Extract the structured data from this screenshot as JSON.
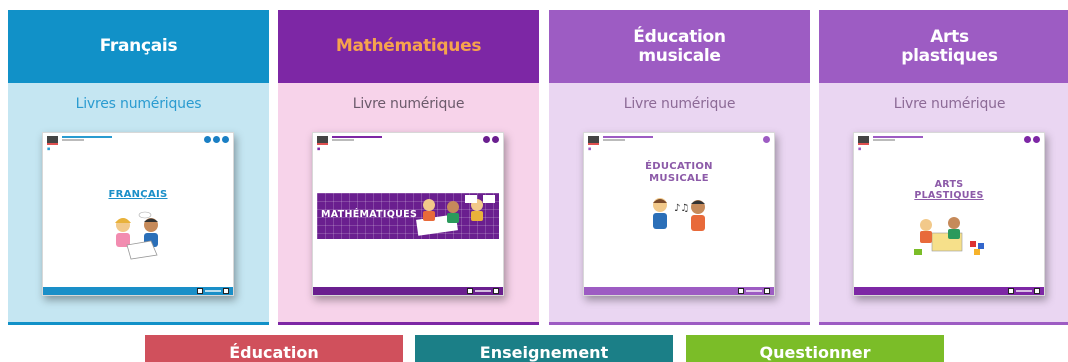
{
  "cards": [
    {
      "id": "francais",
      "title": "Français",
      "subtitle": "Livres numériques",
      "cover_title": "FRANÇAIS"
    },
    {
      "id": "maths",
      "title": "Mathématiques",
      "subtitle": "Livre numérique",
      "cover_title": "MATHÉMATIQUES"
    },
    {
      "id": "musique",
      "title_line1": "Éducation",
      "title_line2": "musicale",
      "subtitle": "Livre numérique",
      "cover_title_line1": "ÉDUCATION",
      "cover_title_line2": "MUSICALE"
    },
    {
      "id": "arts",
      "title_line1": "Arts",
      "title_line2": "plastiques",
      "subtitle": "Livre numérique",
      "cover_title_line1": "ARTS",
      "cover_title_line2": "PLASTIQUES"
    }
  ],
  "bottom_buttons": [
    "Éducation",
    "Enseignement",
    "Questionner"
  ],
  "colors": {
    "francais_header": "#1191c8",
    "francais_body": "#c5e6f2",
    "maths_header": "#7d27a5",
    "maths_title": "#f6a34d",
    "maths_body": "#f7d3ea",
    "musique_header": "#9d5cc3",
    "musique_body": "#ead6f2",
    "arts_header": "#9d5cc3",
    "arts_body": "#ead6f2",
    "btn_education": "#d0505c",
    "btn_enseignement": "#1b7f87",
    "btn_questionner": "#7bbd28"
  },
  "icons": [
    "home-icon",
    "help-icon",
    "settings-icon",
    "prev-page-icon",
    "next-page-icon"
  ]
}
